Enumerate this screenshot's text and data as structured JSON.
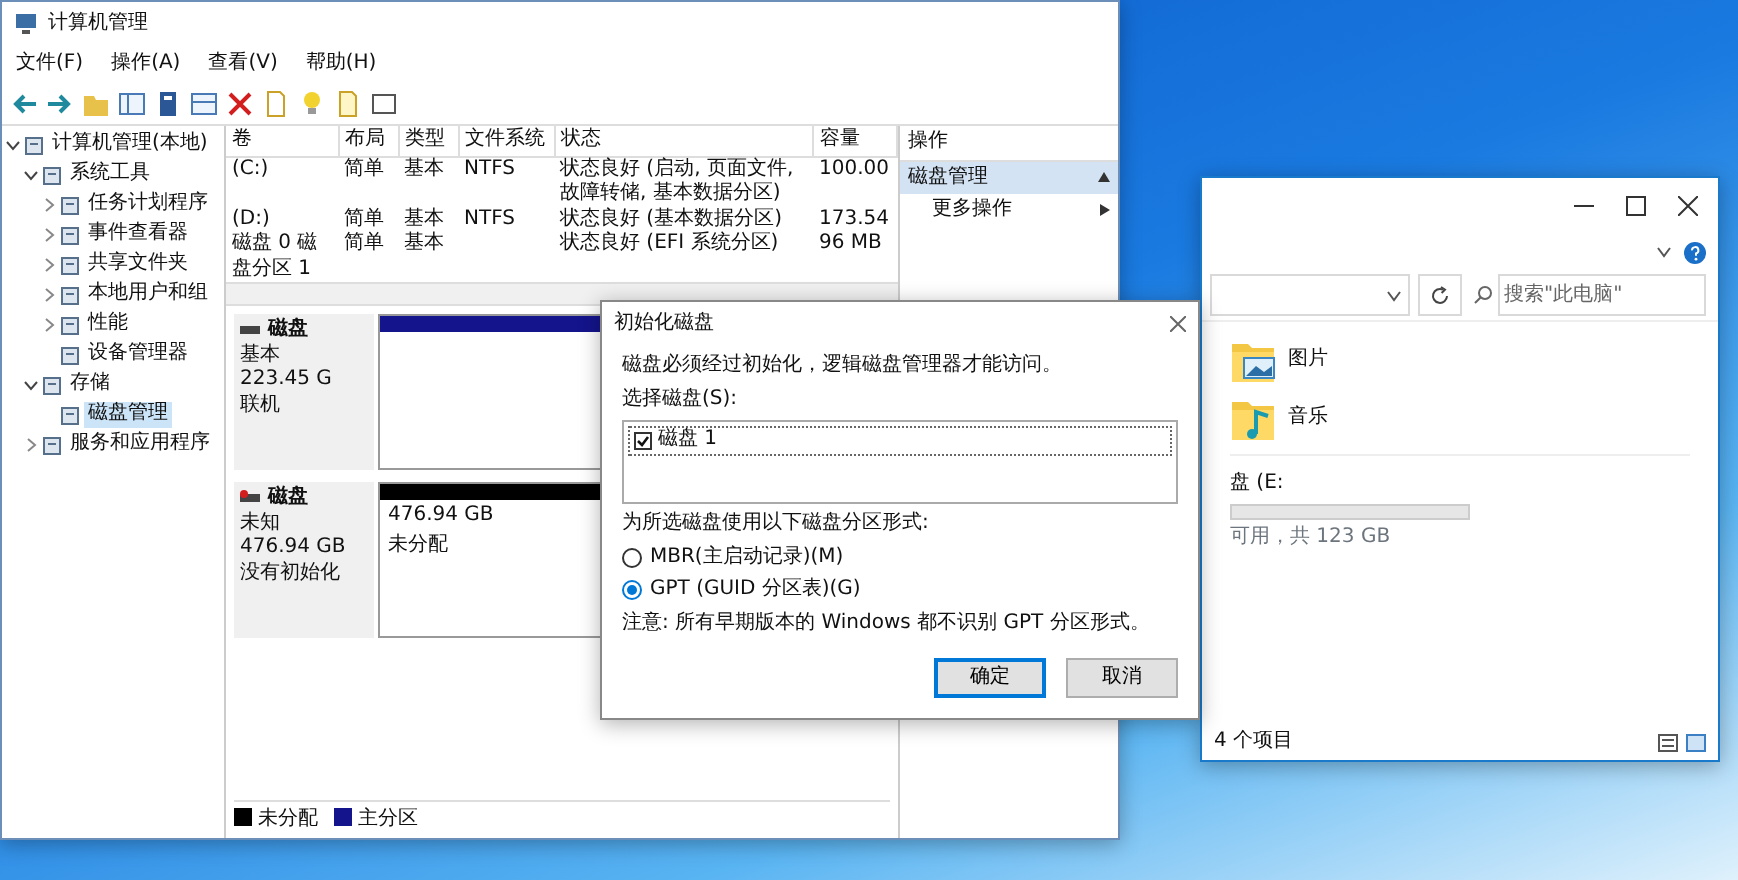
{
  "computer_management": {
    "title": "计算机管理",
    "menu": [
      "文件(F)",
      "操作(A)",
      "查看(V)",
      "帮助(H)"
    ],
    "tree": [
      {
        "label": "计算机管理(本地)",
        "kind": "branch",
        "expanded": true,
        "selected": false,
        "children": [
          {
            "label": "系统工具",
            "kind": "branch",
            "expanded": true,
            "selected": false,
            "children": [
              {
                "label": "任务计划程序",
                "kind": "branch",
                "expanded": false,
                "selected": false
              },
              {
                "label": "事件查看器",
                "kind": "branch",
                "expanded": false,
                "selected": false
              },
              {
                "label": "共享文件夹",
                "kind": "branch",
                "expanded": false,
                "selected": false
              },
              {
                "label": "本地用户和组",
                "kind": "branch",
                "expanded": false,
                "selected": false
              },
              {
                "label": "性能",
                "kind": "branch",
                "expanded": false,
                "selected": false
              },
              {
                "label": "设备管理器",
                "kind": "leaf",
                "selected": false
              }
            ]
          },
          {
            "label": "存储",
            "kind": "branch",
            "expanded": true,
            "selected": false,
            "children": [
              {
                "label": "磁盘管理",
                "kind": "leaf",
                "selected": true
              }
            ]
          },
          {
            "label": "服务和应用程序",
            "kind": "branch",
            "expanded": false,
            "selected": false
          }
        ]
      }
    ],
    "columns": [
      "卷",
      "布局",
      "类型",
      "文件系统",
      "状态",
      "容量"
    ],
    "volumes": [
      {
        "volume": "(C:)",
        "layout": "简单",
        "type": "基本",
        "file_system": "NTFS",
        "status": "状态良好 (启动, 页面文件, 故障转储, 基本数据分区)",
        "capacity": "100.00"
      },
      {
        "volume": "(D:)",
        "layout": "简单",
        "type": "基本",
        "file_system": "NTFS",
        "status": "状态良好 (基本数据分区)",
        "capacity": "173.54"
      },
      {
        "volume": "磁盘 0 磁盘分区 1",
        "layout": "简单",
        "type": "基本",
        "status": "状态良好 (EFI 系统分区)",
        "capacity": "96 MB"
      }
    ],
    "disks": [
      {
        "name": "磁盘",
        "kind": "basic",
        "type": "基本",
        "size": "223.45 G",
        "status": "联机",
        "partitions": [
          {
            "color": "#14148c"
          }
        ]
      },
      {
        "name": "磁盘",
        "kind": "unknown",
        "type": "未知",
        "size": "476.94 GB",
        "status": "没有初始化",
        "partitions": [
          {
            "size": "476.94 GB",
            "status": "未分配",
            "color": "#000000"
          }
        ]
      }
    ],
    "legend": [
      {
        "label": "未分配",
        "color": "#000000"
      },
      {
        "label": "主分区",
        "color": "#14148c"
      }
    ],
    "actions": {
      "header": "操作",
      "items": [
        {
          "label": "磁盘管理",
          "kind": "section"
        },
        {
          "label": "更多操作",
          "kind": "item"
        }
      ]
    }
  },
  "dialog": {
    "title": "初始化磁盘",
    "message": "磁盘必须经过初始化，逻辑磁盘管理器才能访问。",
    "disk_list_label": "选择磁盘(S):",
    "disks": [
      {
        "label": "磁盘 1",
        "checked": true
      }
    ],
    "style_label": "为所选磁盘使用以下磁盘分区形式:",
    "styles": [
      {
        "label": "MBR(主启动记录)(M)",
        "selected": false
      },
      {
        "label": "GPT (GUID 分区表)(G)",
        "selected": true
      }
    ],
    "note": "注意: 所有早期版本的 Windows 都不识别 GPT 分区形式。",
    "buttons": [
      "确定",
      "取消"
    ]
  },
  "explorer": {
    "search": {
      "placeholder": "搜索\"此电脑\""
    },
    "folders": [
      {
        "label": "图片",
        "kind": "pictures"
      },
      {
        "label": "音乐",
        "kind": "music"
      }
    ],
    "drive": {
      "label": "盘 (E:",
      "space": "可用，共 123 GB"
    },
    "status": "4 个项目"
  }
}
